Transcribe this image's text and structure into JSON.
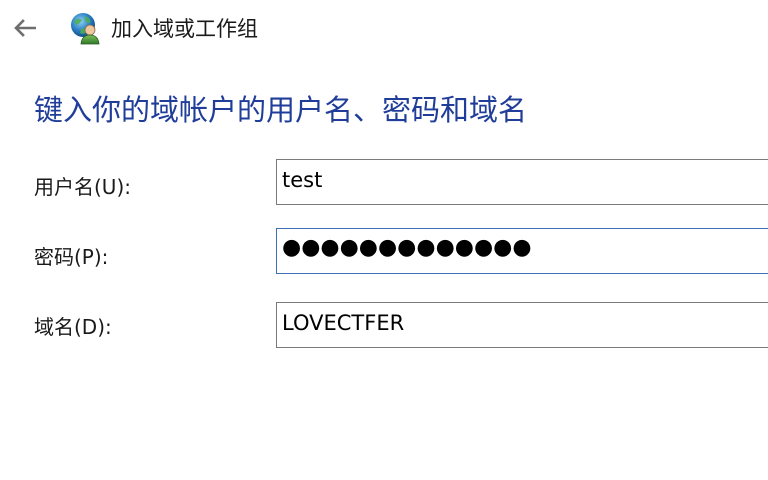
{
  "titlebar": {
    "back_icon": "arrow-left-icon",
    "app_icon": "network-domain-icon",
    "title": "加入域或工作组"
  },
  "heading": "键入你的域帐户的用户名、密码和域名",
  "form": {
    "username": {
      "label": "用户名(U):",
      "value": "test"
    },
    "password": {
      "label": "密码(P):",
      "value": "●●●●●●●●●●●●●"
    },
    "domain": {
      "label": "域名(D):",
      "value": "LOVECTFER"
    }
  },
  "colors": {
    "heading": "#1f3d99",
    "focus_border": "#3b6fb6",
    "border": "#7a7a7a"
  }
}
